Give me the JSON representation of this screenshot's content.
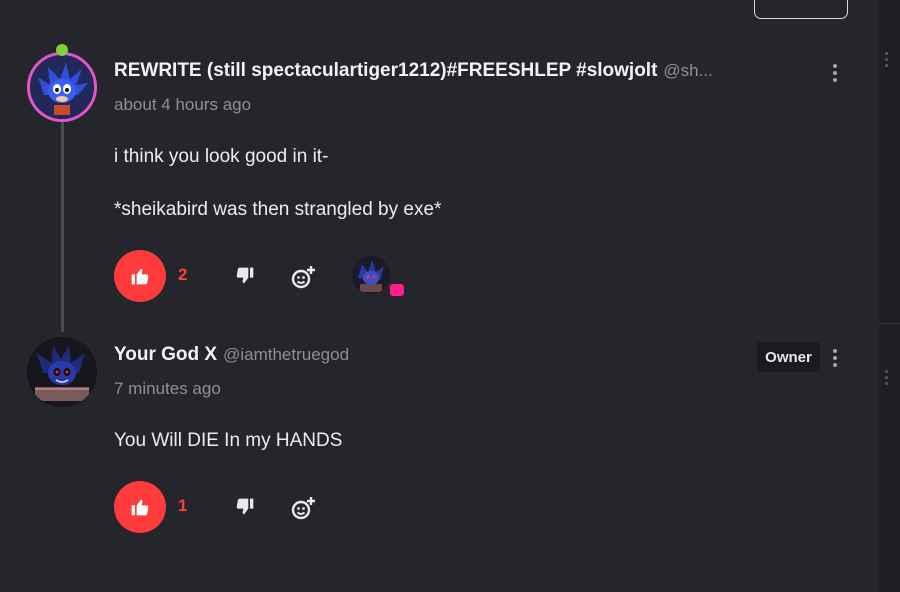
{
  "comments": [
    {
      "name": "REWRITE (still spectaculartiger1212)#FREESHLEP #slowjolt",
      "handle": "@sh...",
      "time": "about 4 hours ago",
      "paragraphs": [
        "i think you look good in it-",
        "*sheikabird was then strangled by exe*"
      ],
      "likes": "2"
    },
    {
      "name": "Your God X",
      "handle": "@iamthetruegod",
      "badge": "Owner",
      "time": "7 minutes ago",
      "paragraphs": [
        "You Will DIE In my HANDS"
      ],
      "likes": "1"
    }
  ],
  "colors": {
    "background": "#25252c",
    "like_accent": "#ff3b3b",
    "reply_badge": "#ff1e8c",
    "muted_text": "#8e8e96"
  },
  "icons": {
    "like": "thumbs-up-icon",
    "dislike": "thumbs-down-icon",
    "reply": "add-reply-icon",
    "more": "kebab-menu-icon"
  }
}
